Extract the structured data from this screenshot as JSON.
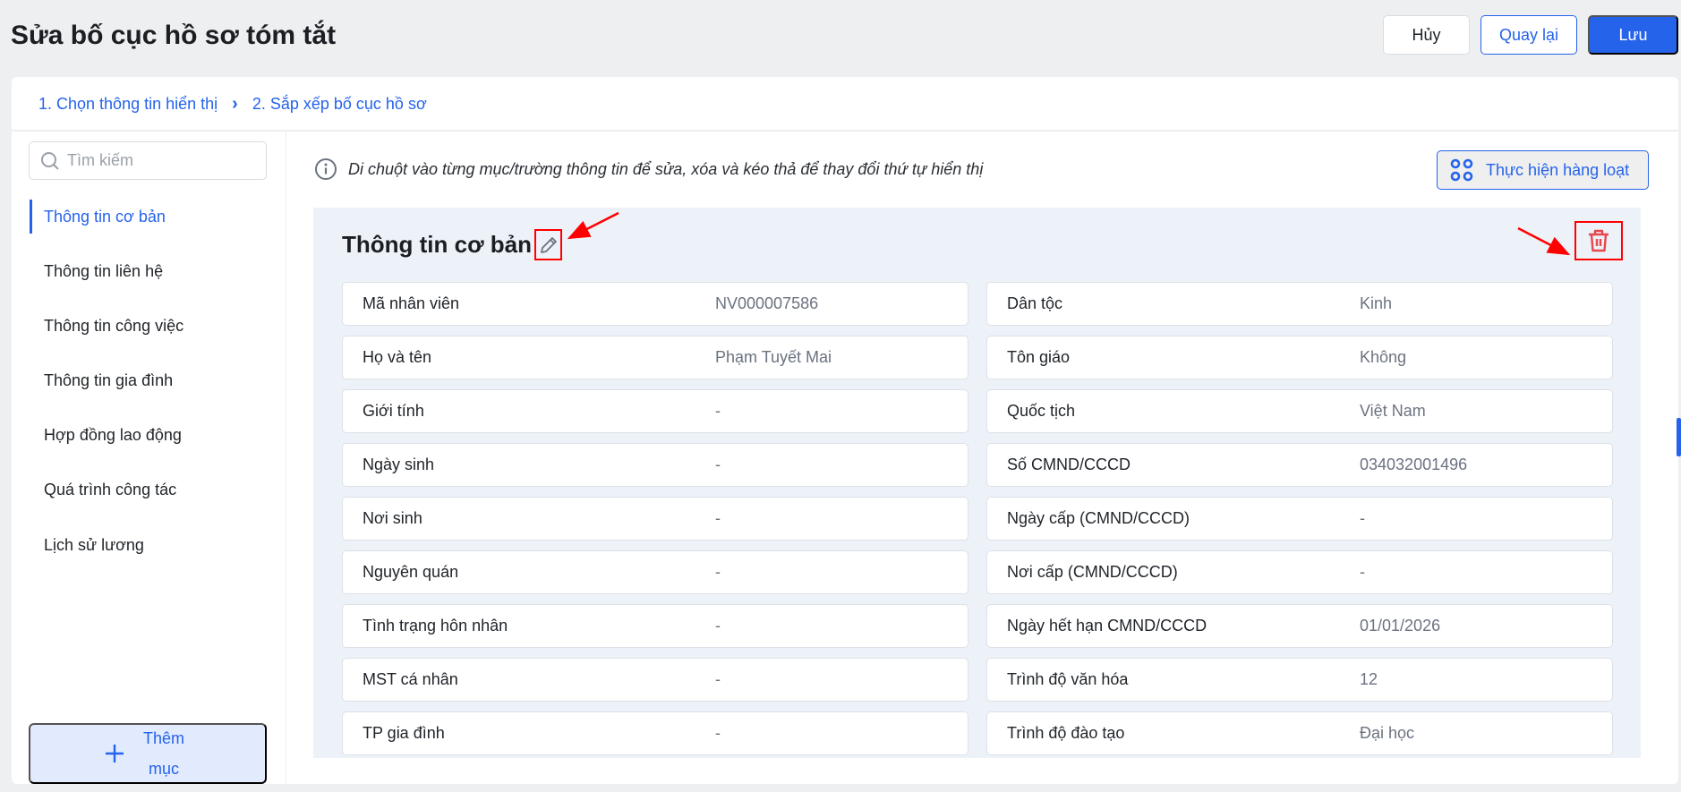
{
  "header": {
    "title": "Sửa bố cục hồ sơ tóm tắt",
    "cancel": "Hủy",
    "back": "Quay lại",
    "save": "Lưu"
  },
  "steps": [
    "1. Chọn thông tin hiển thị",
    "2. Sắp xếp bố cục hồ sơ"
  ],
  "sidebar": {
    "search_placeholder": "Tìm kiếm",
    "items": [
      "Thông tin cơ bản",
      "Thông tin liên hệ",
      "Thông tin công việc",
      "Thông tin gia đình",
      "Hợp đồng lao động",
      "Quá trình công tác",
      "Lịch sử lương"
    ],
    "active": 0,
    "add_label": "Thêm mục"
  },
  "main": {
    "info": "Di chuột vào từng mục/trường thông tin để sửa, xóa và kéo thả để thay đổi thứ tự hiển thị",
    "bulk": "Thực hiện hàng loạt",
    "section_title": "Thông tin cơ bản",
    "left_fields": [
      {
        "label": "Mã nhân viên",
        "value": "NV000007586"
      },
      {
        "label": "Họ và tên",
        "value": "Phạm Tuyết Mai"
      },
      {
        "label": "Giới tính",
        "value": "-"
      },
      {
        "label": "Ngày sinh",
        "value": "-"
      },
      {
        "label": "Nơi sinh",
        "value": "-"
      },
      {
        "label": "Nguyên quán",
        "value": "-"
      },
      {
        "label": "Tình trạng hôn nhân",
        "value": "-"
      },
      {
        "label": "MST cá nhân",
        "value": "-"
      },
      {
        "label": "TP gia đình",
        "value": "-"
      }
    ],
    "right_fields": [
      {
        "label": "Dân tộc",
        "value": "Kinh"
      },
      {
        "label": "Tôn giáo",
        "value": "Không"
      },
      {
        "label": "Quốc tịch",
        "value": "Việt Nam"
      },
      {
        "label": "Số CMND/CCCD",
        "value": "034032001496"
      },
      {
        "label": "Ngày cấp (CMND/CCCD)",
        "value": "-"
      },
      {
        "label": "Nơi cấp (CMND/CCCD)",
        "value": "-"
      },
      {
        "label": "Ngày hết hạn CMND/CCCD",
        "value": "01/01/2026"
      },
      {
        "label": "Trình độ văn hóa",
        "value": "12"
      },
      {
        "label": "Trình độ đào tạo",
        "value": "Đại học"
      }
    ]
  },
  "colors": {
    "accent": "#2563eb",
    "danger": "#e5484d",
    "annotation": "#ff0000"
  }
}
